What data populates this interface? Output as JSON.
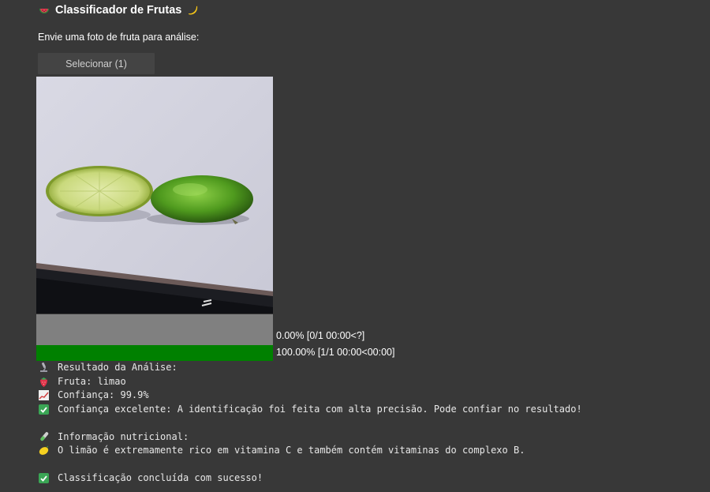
{
  "header": {
    "title": "Classificador de Frutas",
    "left_icon": "watermelon-icon",
    "right_icon": "banana-icon"
  },
  "upload": {
    "prompt": "Envie uma foto de fruta para análise:",
    "button_label": "Selecionar (1)"
  },
  "image": {
    "description_icon": "uploaded-photo"
  },
  "progress": [
    {
      "text": "0.00% [0/1 00:00<?]",
      "value": 0.0,
      "color": "#808080"
    },
    {
      "text": "100.00% [1/1 00:00<00:00]",
      "value": 1.0,
      "color": "#008000"
    }
  ],
  "result": {
    "heading": "Resultado da Análise:",
    "fruit": "Fruta: limao",
    "confidence": "Confiança: 99.9%",
    "confidence_note": "Confiança excelente: A identificação foi feita com alta precisão. Pode confiar no resultado!",
    "nutrition_heading": "Informação nutricional:",
    "nutrition_text": "O limão é extremamente rico em vitamina C e também contém vitaminas do complexo B.",
    "final_status": "Classificação concluída com sucesso!"
  },
  "icons": {
    "heading": "microscope-icon",
    "fruit": "strawberry-icon",
    "confidence": "chart-icon",
    "check": "check-icon",
    "nutrition": "test-tube-icon",
    "lemon": "lemon-icon"
  },
  "colors": {
    "background": "#383838",
    "progress_done": "#008000",
    "progress_pending": "#808080",
    "check_green": "#3aa655"
  }
}
